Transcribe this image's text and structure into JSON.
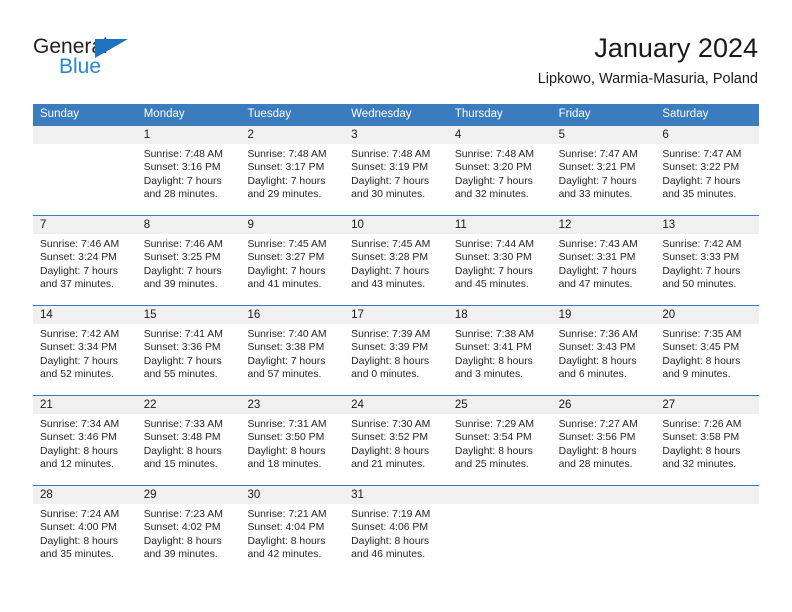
{
  "brand": {
    "name_dark": "General",
    "name_blue": "Blue",
    "accent_color": "#2787d6",
    "triangle_color": "#1f72bd"
  },
  "header": {
    "title": "January 2024",
    "subtitle": "Lipkowo, Warmia-Masuria, Poland"
  },
  "theme": {
    "header_bg": "#3a7cbe",
    "daynum_bg": "#f0f0f0",
    "text": "#1a1a1a"
  },
  "weekdays": [
    "Sunday",
    "Monday",
    "Tuesday",
    "Wednesday",
    "Thursday",
    "Friday",
    "Saturday"
  ],
  "weeks": [
    [
      {
        "day": "",
        "sunrise": "",
        "sunset": "",
        "daylight1": "",
        "daylight2": ""
      },
      {
        "day": "1",
        "sunrise": "Sunrise: 7:48 AM",
        "sunset": "Sunset: 3:16 PM",
        "daylight1": "Daylight: 7 hours",
        "daylight2": "and 28 minutes."
      },
      {
        "day": "2",
        "sunrise": "Sunrise: 7:48 AM",
        "sunset": "Sunset: 3:17 PM",
        "daylight1": "Daylight: 7 hours",
        "daylight2": "and 29 minutes."
      },
      {
        "day": "3",
        "sunrise": "Sunrise: 7:48 AM",
        "sunset": "Sunset: 3:19 PM",
        "daylight1": "Daylight: 7 hours",
        "daylight2": "and 30 minutes."
      },
      {
        "day": "4",
        "sunrise": "Sunrise: 7:48 AM",
        "sunset": "Sunset: 3:20 PM",
        "daylight1": "Daylight: 7 hours",
        "daylight2": "and 32 minutes."
      },
      {
        "day": "5",
        "sunrise": "Sunrise: 7:47 AM",
        "sunset": "Sunset: 3:21 PM",
        "daylight1": "Daylight: 7 hours",
        "daylight2": "and 33 minutes."
      },
      {
        "day": "6",
        "sunrise": "Sunrise: 7:47 AM",
        "sunset": "Sunset: 3:22 PM",
        "daylight1": "Daylight: 7 hours",
        "daylight2": "and 35 minutes."
      }
    ],
    [
      {
        "day": "7",
        "sunrise": "Sunrise: 7:46 AM",
        "sunset": "Sunset: 3:24 PM",
        "daylight1": "Daylight: 7 hours",
        "daylight2": "and 37 minutes."
      },
      {
        "day": "8",
        "sunrise": "Sunrise: 7:46 AM",
        "sunset": "Sunset: 3:25 PM",
        "daylight1": "Daylight: 7 hours",
        "daylight2": "and 39 minutes."
      },
      {
        "day": "9",
        "sunrise": "Sunrise: 7:45 AM",
        "sunset": "Sunset: 3:27 PM",
        "daylight1": "Daylight: 7 hours",
        "daylight2": "and 41 minutes."
      },
      {
        "day": "10",
        "sunrise": "Sunrise: 7:45 AM",
        "sunset": "Sunset: 3:28 PM",
        "daylight1": "Daylight: 7 hours",
        "daylight2": "and 43 minutes."
      },
      {
        "day": "11",
        "sunrise": "Sunrise: 7:44 AM",
        "sunset": "Sunset: 3:30 PM",
        "daylight1": "Daylight: 7 hours",
        "daylight2": "and 45 minutes."
      },
      {
        "day": "12",
        "sunrise": "Sunrise: 7:43 AM",
        "sunset": "Sunset: 3:31 PM",
        "daylight1": "Daylight: 7 hours",
        "daylight2": "and 47 minutes."
      },
      {
        "day": "13",
        "sunrise": "Sunrise: 7:42 AM",
        "sunset": "Sunset: 3:33 PM",
        "daylight1": "Daylight: 7 hours",
        "daylight2": "and 50 minutes."
      }
    ],
    [
      {
        "day": "14",
        "sunrise": "Sunrise: 7:42 AM",
        "sunset": "Sunset: 3:34 PM",
        "daylight1": "Daylight: 7 hours",
        "daylight2": "and 52 minutes."
      },
      {
        "day": "15",
        "sunrise": "Sunrise: 7:41 AM",
        "sunset": "Sunset: 3:36 PM",
        "daylight1": "Daylight: 7 hours",
        "daylight2": "and 55 minutes."
      },
      {
        "day": "16",
        "sunrise": "Sunrise: 7:40 AM",
        "sunset": "Sunset: 3:38 PM",
        "daylight1": "Daylight: 7 hours",
        "daylight2": "and 57 minutes."
      },
      {
        "day": "17",
        "sunrise": "Sunrise: 7:39 AM",
        "sunset": "Sunset: 3:39 PM",
        "daylight1": "Daylight: 8 hours",
        "daylight2": "and 0 minutes."
      },
      {
        "day": "18",
        "sunrise": "Sunrise: 7:38 AM",
        "sunset": "Sunset: 3:41 PM",
        "daylight1": "Daylight: 8 hours",
        "daylight2": "and 3 minutes."
      },
      {
        "day": "19",
        "sunrise": "Sunrise: 7:36 AM",
        "sunset": "Sunset: 3:43 PM",
        "daylight1": "Daylight: 8 hours",
        "daylight2": "and 6 minutes."
      },
      {
        "day": "20",
        "sunrise": "Sunrise: 7:35 AM",
        "sunset": "Sunset: 3:45 PM",
        "daylight1": "Daylight: 8 hours",
        "daylight2": "and 9 minutes."
      }
    ],
    [
      {
        "day": "21",
        "sunrise": "Sunrise: 7:34 AM",
        "sunset": "Sunset: 3:46 PM",
        "daylight1": "Daylight: 8 hours",
        "daylight2": "and 12 minutes."
      },
      {
        "day": "22",
        "sunrise": "Sunrise: 7:33 AM",
        "sunset": "Sunset: 3:48 PM",
        "daylight1": "Daylight: 8 hours",
        "daylight2": "and 15 minutes."
      },
      {
        "day": "23",
        "sunrise": "Sunrise: 7:31 AM",
        "sunset": "Sunset: 3:50 PM",
        "daylight1": "Daylight: 8 hours",
        "daylight2": "and 18 minutes."
      },
      {
        "day": "24",
        "sunrise": "Sunrise: 7:30 AM",
        "sunset": "Sunset: 3:52 PM",
        "daylight1": "Daylight: 8 hours",
        "daylight2": "and 21 minutes."
      },
      {
        "day": "25",
        "sunrise": "Sunrise: 7:29 AM",
        "sunset": "Sunset: 3:54 PM",
        "daylight1": "Daylight: 8 hours",
        "daylight2": "and 25 minutes."
      },
      {
        "day": "26",
        "sunrise": "Sunrise: 7:27 AM",
        "sunset": "Sunset: 3:56 PM",
        "daylight1": "Daylight: 8 hours",
        "daylight2": "and 28 minutes."
      },
      {
        "day": "27",
        "sunrise": "Sunrise: 7:26 AM",
        "sunset": "Sunset: 3:58 PM",
        "daylight1": "Daylight: 8 hours",
        "daylight2": "and 32 minutes."
      }
    ],
    [
      {
        "day": "28",
        "sunrise": "Sunrise: 7:24 AM",
        "sunset": "Sunset: 4:00 PM",
        "daylight1": "Daylight: 8 hours",
        "daylight2": "and 35 minutes."
      },
      {
        "day": "29",
        "sunrise": "Sunrise: 7:23 AM",
        "sunset": "Sunset: 4:02 PM",
        "daylight1": "Daylight: 8 hours",
        "daylight2": "and 39 minutes."
      },
      {
        "day": "30",
        "sunrise": "Sunrise: 7:21 AM",
        "sunset": "Sunset: 4:04 PM",
        "daylight1": "Daylight: 8 hours",
        "daylight2": "and 42 minutes."
      },
      {
        "day": "31",
        "sunrise": "Sunrise: 7:19 AM",
        "sunset": "Sunset: 4:06 PM",
        "daylight1": "Daylight: 8 hours",
        "daylight2": "and 46 minutes."
      },
      {
        "day": "",
        "sunrise": "",
        "sunset": "",
        "daylight1": "",
        "daylight2": ""
      },
      {
        "day": "",
        "sunrise": "",
        "sunset": "",
        "daylight1": "",
        "daylight2": ""
      },
      {
        "day": "",
        "sunrise": "",
        "sunset": "",
        "daylight1": "",
        "daylight2": ""
      }
    ]
  ]
}
